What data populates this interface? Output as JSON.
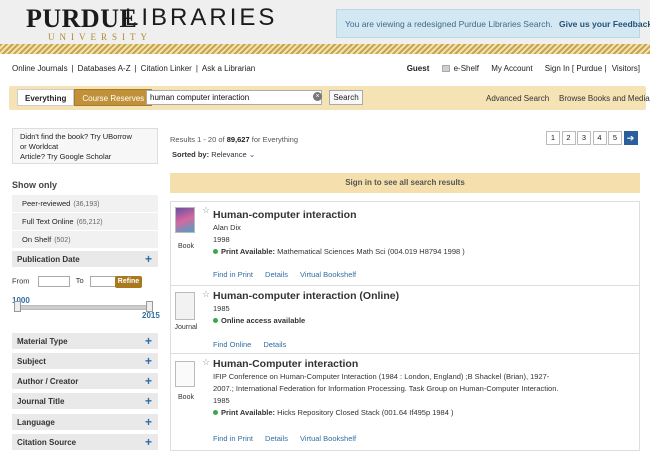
{
  "header": {
    "logo_purdue": "PURDUE",
    "logo_university": "UNIVERSITY",
    "logo_libraries": "LIBRARIES",
    "notice_text": "You are viewing a redesigned Purdue Libraries Search.",
    "notice_link": "Give us your Feedback »"
  },
  "topnav": {
    "links": [
      "Online Journals",
      "Databases A-Z",
      "Citation Linker",
      "Ask a Librarian"
    ],
    "guest": "Guest",
    "eshelf": "e-Shelf",
    "my_account": "My Account",
    "sign_in": "Sign In [ Purdue |",
    "visitors": "Visitors]"
  },
  "search": {
    "tab_everything": "Everything",
    "tab_course_reserves": "Course Reserves",
    "query": "human computer interaction",
    "clear_label": "×",
    "button": "Search",
    "advanced": "Advanced Search",
    "browse": "Browse Books and Media"
  },
  "sidebar": {
    "suggest_line1": "Didn't find the book? Try UBorrow",
    "suggest_line2": "or Worldcat",
    "suggest_line3": "Article? Try Google Scholar",
    "show_only": "Show only",
    "show_items": [
      {
        "label": "Peer-reviewed",
        "count": "(36,193)"
      },
      {
        "label": "Full Text Online",
        "count": "(65,212)"
      },
      {
        "label": "On Shelf",
        "count": "(502)"
      }
    ],
    "pub_date": "Publication Date",
    "from": "From",
    "to": "To",
    "refine": "Refine",
    "year_min": "1000",
    "year_max": "2015",
    "facets": [
      "Material Type",
      "Subject",
      "Author / Creator",
      "Journal Title",
      "Language",
      "Citation Source"
    ]
  },
  "results": {
    "count_prefix": "Results 1 - 20 of",
    "count_total": "89,627",
    "count_suffix": "for Everything",
    "sorted_by_label": "Sorted by:",
    "sorted_by_value": "Relevance",
    "pages": [
      "1",
      "2",
      "3",
      "4",
      "5"
    ],
    "next": "➔",
    "signin_banner": "Sign in to see all search results",
    "items": [
      {
        "title": "Human-computer interaction",
        "type": "Book",
        "line1": "Alan Dix",
        "line2": "1998",
        "avail_label": "Print Available:",
        "avail_text": "Mathematical Sciences Math Sci (004.019 H8794 1998 )",
        "links": [
          "Find in Print",
          "Details",
          "Virtual Bookshelf"
        ]
      },
      {
        "title": "Human-computer interaction (Online)",
        "type": "Journal",
        "line1": "1985",
        "avail_label": "Online access available",
        "links": [
          "Find Online",
          "Details"
        ]
      },
      {
        "title": "Human-Computer interaction",
        "type": "Book",
        "line1": "IFIP Conference on Human-Computer Interaction (1984 : London, England) ;B Shackel (Brian), 1927-",
        "line2": "2007.; International Federation for Information Processing. Task Group on Human-Computer Interaction.",
        "line3": "1985",
        "avail_label": "Print Available:",
        "avail_text": "Hicks Repository Closed Stack (001.64 If495p 1984 )",
        "links": [
          "Find in Print",
          "Details",
          "Virtual Bookshelf"
        ]
      }
    ]
  },
  "colors": {
    "accent_blue": "#2f6ea5",
    "gold": "#c1913a",
    "banner": "#f5e0ad",
    "available_green": "#3aa74a"
  }
}
